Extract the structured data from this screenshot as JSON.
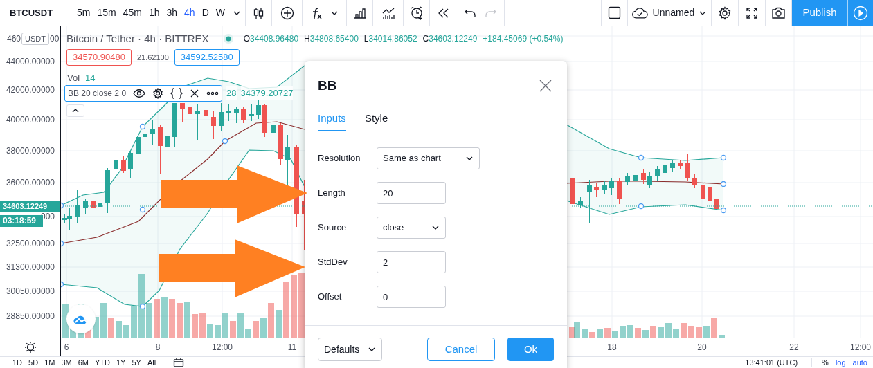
{
  "toolbar": {
    "symbol": "BTCUSDT",
    "intervals": [
      {
        "label": "5m",
        "selected": false
      },
      {
        "label": "15m",
        "selected": false
      },
      {
        "label": "45m",
        "selected": false
      },
      {
        "label": "1h",
        "selected": false
      },
      {
        "label": "3h",
        "selected": false
      },
      {
        "label": "4h",
        "selected": true
      },
      {
        "label": "D",
        "selected": false
      },
      {
        "label": "W",
        "selected": false
      }
    ],
    "redo_disabled": true,
    "layout_name": "Unnamed",
    "publish": "Publish"
  },
  "legend": {
    "title": "Bitcoin / Tether · 4h · BITTREX",
    "ohlc": [
      {
        "label": "O",
        "value": "34408.96480"
      },
      {
        "label": "H",
        "value": "34808.65400"
      },
      {
        "label": "L",
        "value": "34014.86052"
      },
      {
        "label": "C",
        "value": "34603.12249"
      }
    ],
    "change": "+184.45069 (+0.54%)",
    "quotes": [
      {
        "text": "34570.90480",
        "kind": "bid"
      },
      {
        "text": "21.62100",
        "kind": "spread"
      },
      {
        "text": "34592.52580",
        "kind": "ask"
      }
    ],
    "volume": {
      "label": "Vol",
      "value": "14"
    },
    "indicator": {
      "label": "BB 20 close 2 0",
      "values": [
        "28",
        "34379.20727"
      ]
    }
  },
  "price_axis": {
    "currency": "USDT",
    "top_label_parts": [
      "460",
      "00"
    ],
    "labels": [
      "44000.00000",
      "42000.00000",
      "40000.00000",
      "38000.00000",
      "36000.00000",
      "000",
      "32500.00000",
      "31300.00000",
      "30050.00000",
      "28850.00000"
    ],
    "last_price": "34603.12249",
    "countdown": "03:18:59"
  },
  "time_axis": {
    "labels": [
      "6",
      "8",
      "12:00",
      "11",
      "18",
      "20",
      "22",
      "12:00"
    ]
  },
  "dialog": {
    "title": "BB",
    "tabs": [
      {
        "label": "Inputs",
        "selected": true
      },
      {
        "label": "Style",
        "selected": false
      }
    ],
    "fields": [
      {
        "label": "Resolution",
        "kind": "select",
        "value": "Same as chart"
      },
      {
        "label": "Length",
        "kind": "input",
        "value": "20"
      },
      {
        "label": "Source",
        "kind": "select",
        "value": "close"
      },
      {
        "label": "StdDev",
        "kind": "input",
        "value": "2"
      },
      {
        "label": "Offset",
        "kind": "input",
        "value": "0"
      }
    ],
    "defaults": "Defaults",
    "cancel": "Cancel",
    "ok": "Ok"
  },
  "bottom_bar": {
    "ranges": [
      "1D",
      "5D",
      "1M",
      "3M",
      "6M",
      "YTD",
      "1Y",
      "5Y",
      "All"
    ],
    "time": "13:41:01 (UTC)",
    "toggles": [
      {
        "label": "%",
        "on": false
      },
      {
        "label": "log",
        "on": true
      },
      {
        "label": "auto",
        "on": true
      }
    ]
  }
}
